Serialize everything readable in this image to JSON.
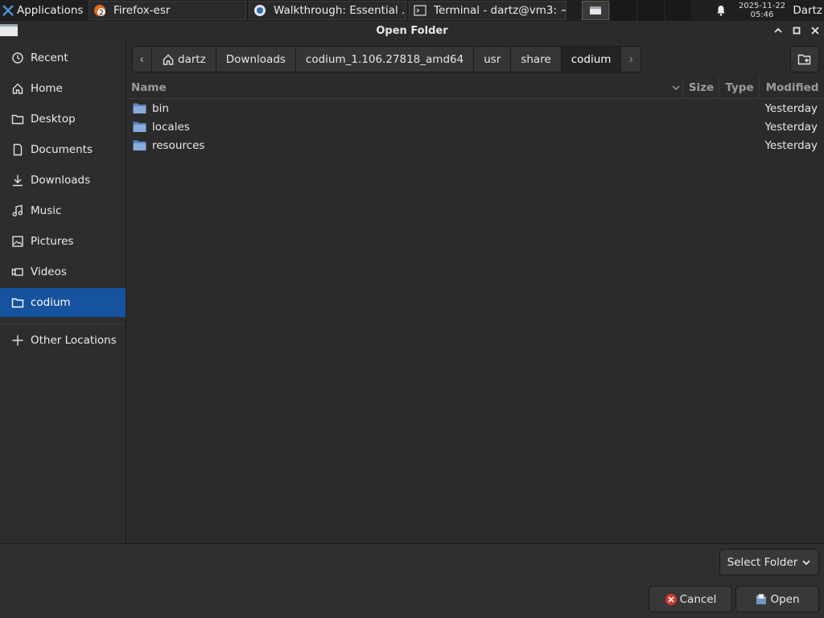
{
  "taskbar": {
    "applications_label": "Applications",
    "tasks": [
      {
        "label": "Firefox-esr",
        "badge": "2"
      },
      {
        "label": "Walkthrough: Essential ..."
      },
      {
        "label": "Terminal - dartz@vm3: ~"
      }
    ],
    "clock_date": "2025-11-22",
    "clock_time": "05:46",
    "user": "Dartz"
  },
  "dialog": {
    "title": "Open Folder"
  },
  "sidebar": {
    "items": [
      {
        "label": "Recent",
        "icon": "clock-icon"
      },
      {
        "label": "Home",
        "icon": "home-icon"
      },
      {
        "label": "Desktop",
        "icon": "folder-icon"
      },
      {
        "label": "Documents",
        "icon": "document-icon"
      },
      {
        "label": "Downloads",
        "icon": "download-icon"
      },
      {
        "label": "Music",
        "icon": "music-icon"
      },
      {
        "label": "Pictures",
        "icon": "picture-icon"
      },
      {
        "label": "Videos",
        "icon": "video-icon"
      },
      {
        "label": "codium",
        "icon": "folder-icon",
        "selected": true
      }
    ],
    "other_locations": "Other Locations"
  },
  "pathbar": {
    "crumbs": [
      "dartz",
      "Downloads",
      "codium_1.106.27818_amd64",
      "usr",
      "share",
      "codium"
    ],
    "current": "codium"
  },
  "filelist": {
    "columns": {
      "name": "Name",
      "size": "Size",
      "type": "Type",
      "modified": "Modified"
    },
    "rows": [
      {
        "name": "bin",
        "modified": "Yesterday"
      },
      {
        "name": "locales",
        "modified": "Yesterday"
      },
      {
        "name": "resources",
        "modified": "Yesterday"
      }
    ]
  },
  "footer": {
    "filter_label": "Select Folder",
    "cancel_label": "Cancel",
    "open_label": "Open"
  },
  "colors": {
    "selection": "#15539e",
    "folder": "#7ea6d9",
    "cancel_icon": "#d9342b"
  }
}
